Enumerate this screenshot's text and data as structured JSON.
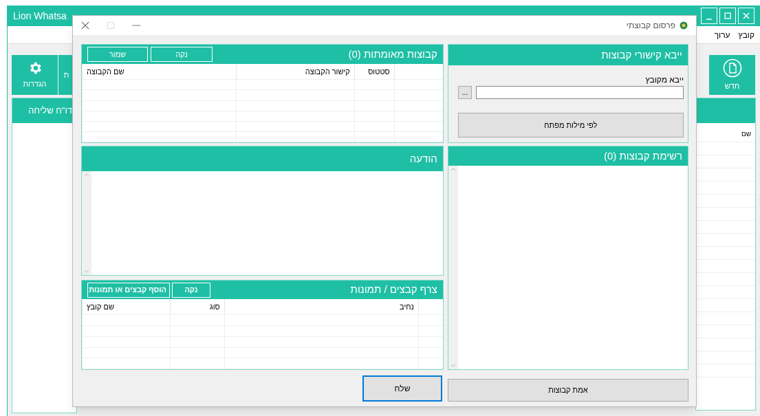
{
  "app": {
    "title": "Lion Whatsa",
    "menu": [
      "קובץ",
      "ערוך"
    ],
    "toolbar_right": [
      {
        "label": "חדש",
        "kind": "new"
      }
    ],
    "toolbar_left": [
      {
        "label": "הגדרות",
        "kind": "settings"
      },
      {
        "label": "ת",
        "kind": "partial"
      }
    ],
    "report_panel": {
      "title": "דו\"ח שליחה"
    },
    "table": {
      "columns": [
        "שם"
      ]
    }
  },
  "dialog": {
    "title": "פרסום קבוצתי",
    "import_panel": {
      "title": "ייבא קישורי קבוצות",
      "file_label": "ייבא מקובץ",
      "browse_button": "...",
      "keywords_button": "לפי מילות מפתח"
    },
    "groups_list": {
      "title": "רשימת קבוצות (0)"
    },
    "verify_button": "אמת קבוצות",
    "verified_panel": {
      "title": "קבוצות מאומתות (0)",
      "buttons": [
        "נקה",
        "שמור"
      ],
      "columns": [
        "",
        "סטטוס",
        "קישור הקבוצה",
        "שם הקבוצה"
      ]
    },
    "message_panel": {
      "title": "הודעה"
    },
    "attach_panel": {
      "title": "צרף קבצים / תמונות",
      "buttons": [
        "נקה",
        "הוסף קבצים או תמונות"
      ],
      "columns": [
        "",
        "נחיב",
        "סוג",
        "שם קובץ"
      ]
    },
    "send_button": "שלח"
  }
}
